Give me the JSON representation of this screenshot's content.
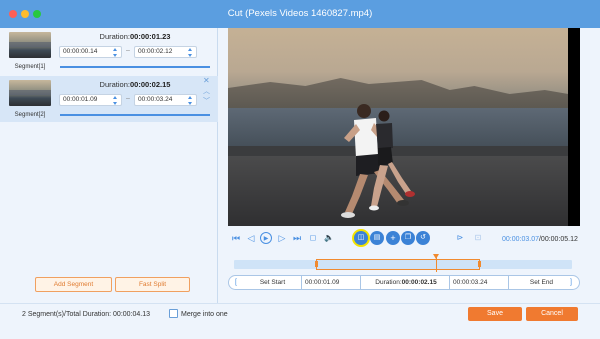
{
  "window": {
    "title": "Cut (Pexels Videos 1460827.mp4)",
    "traffic_lights": [
      "#ff5f57",
      "#febc2e",
      "#28c840"
    ]
  },
  "segments": [
    {
      "label": "Segment[1]",
      "duration_label": "Duration:",
      "duration_value": "00:00:01.23",
      "start": "00:00:00.14",
      "end": "00:00:02.12",
      "selected": false
    },
    {
      "label": "Segment[2]",
      "duration_label": "Duration:",
      "duration_value": "00:00:02.15",
      "start": "00:00:01.09",
      "end": "00:00:03.24",
      "selected": true
    }
  ],
  "range_separator": "–",
  "left_actions": {
    "add_segment": "Add Segment",
    "fast_split": "Fast Split"
  },
  "player": {
    "current_time": "00:00:03.07",
    "total_time": "/00:00:05.12"
  },
  "controls": {
    "set_start": "Set Start",
    "start_value": "00:00:01.09",
    "duration_label": "Duration:",
    "duration_value": "00:00:02.15",
    "end_value": "00:00:03.24",
    "set_end": "Set End"
  },
  "footer": {
    "summary": "2 Segment(s)/Total Duration: 00:00:04.13",
    "merge_label": "Merge into one",
    "merge_checked": false,
    "save": "Save",
    "cancel": "Cancel"
  },
  "colors": {
    "titlebar": "#5b9ee0",
    "accent_blue": "#4a90e2",
    "accent_orange": "#f07a30",
    "highlight": "#f3e300"
  }
}
